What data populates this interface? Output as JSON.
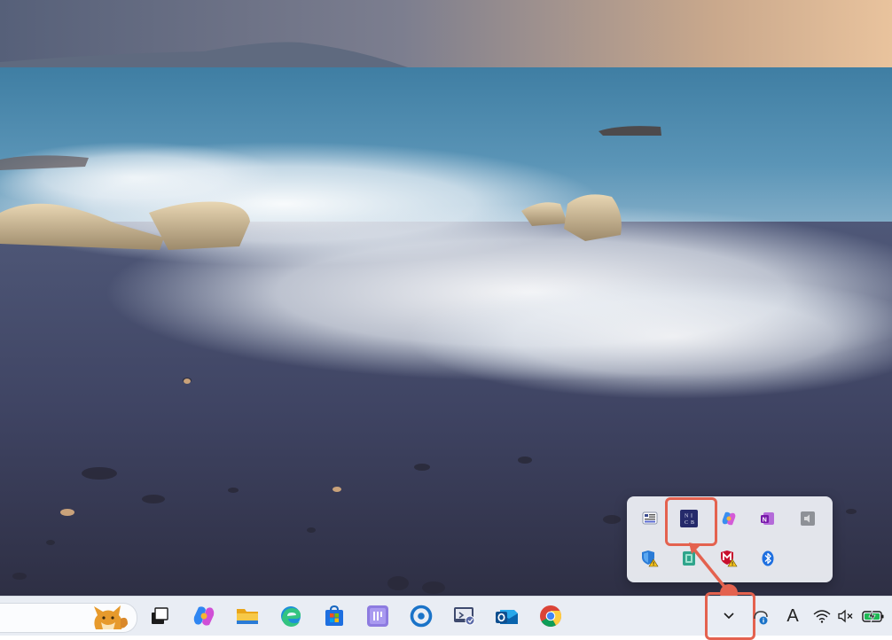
{
  "desktop": {
    "wallpaper": "beach-rocks-waves"
  },
  "colors": {
    "annotation": "#e4624f",
    "taskbar": "#e9edf4",
    "flyout": "#eef0f5"
  },
  "tray_overflow": {
    "row1": [
      {
        "icon": "news-app-icon"
      },
      {
        "icon": "nic-app-icon",
        "label": "N I C B",
        "highlighted": true
      },
      {
        "icon": "copilot-icon"
      },
      {
        "icon": "onenote-icon"
      },
      {
        "icon": "speaker-device-icon"
      }
    ],
    "row2": [
      {
        "icon": "windows-security-warning-icon"
      },
      {
        "icon": "green-app-icon"
      },
      {
        "icon": "mcafee-warning-icon"
      },
      {
        "icon": "bluetooth-icon"
      }
    ]
  },
  "taskbar": {
    "search": {
      "icon": "fox-search-highlight-icon"
    },
    "apps": [
      "task-view-icon",
      "copilot-icon",
      "file-explorer-icon",
      "edge-icon",
      "microsoft-store-icon",
      "calculator-app-icon",
      "cortana-ring-icon",
      "remote-desktop-icon",
      "outlook-icon",
      "chrome-icon"
    ],
    "tray": {
      "chevron": "chevron-up-icon",
      "ime_label": "A",
      "status_icons": [
        "wifi-icon",
        "volume-muted-icon",
        "battery-charging-icon"
      ]
    }
  }
}
